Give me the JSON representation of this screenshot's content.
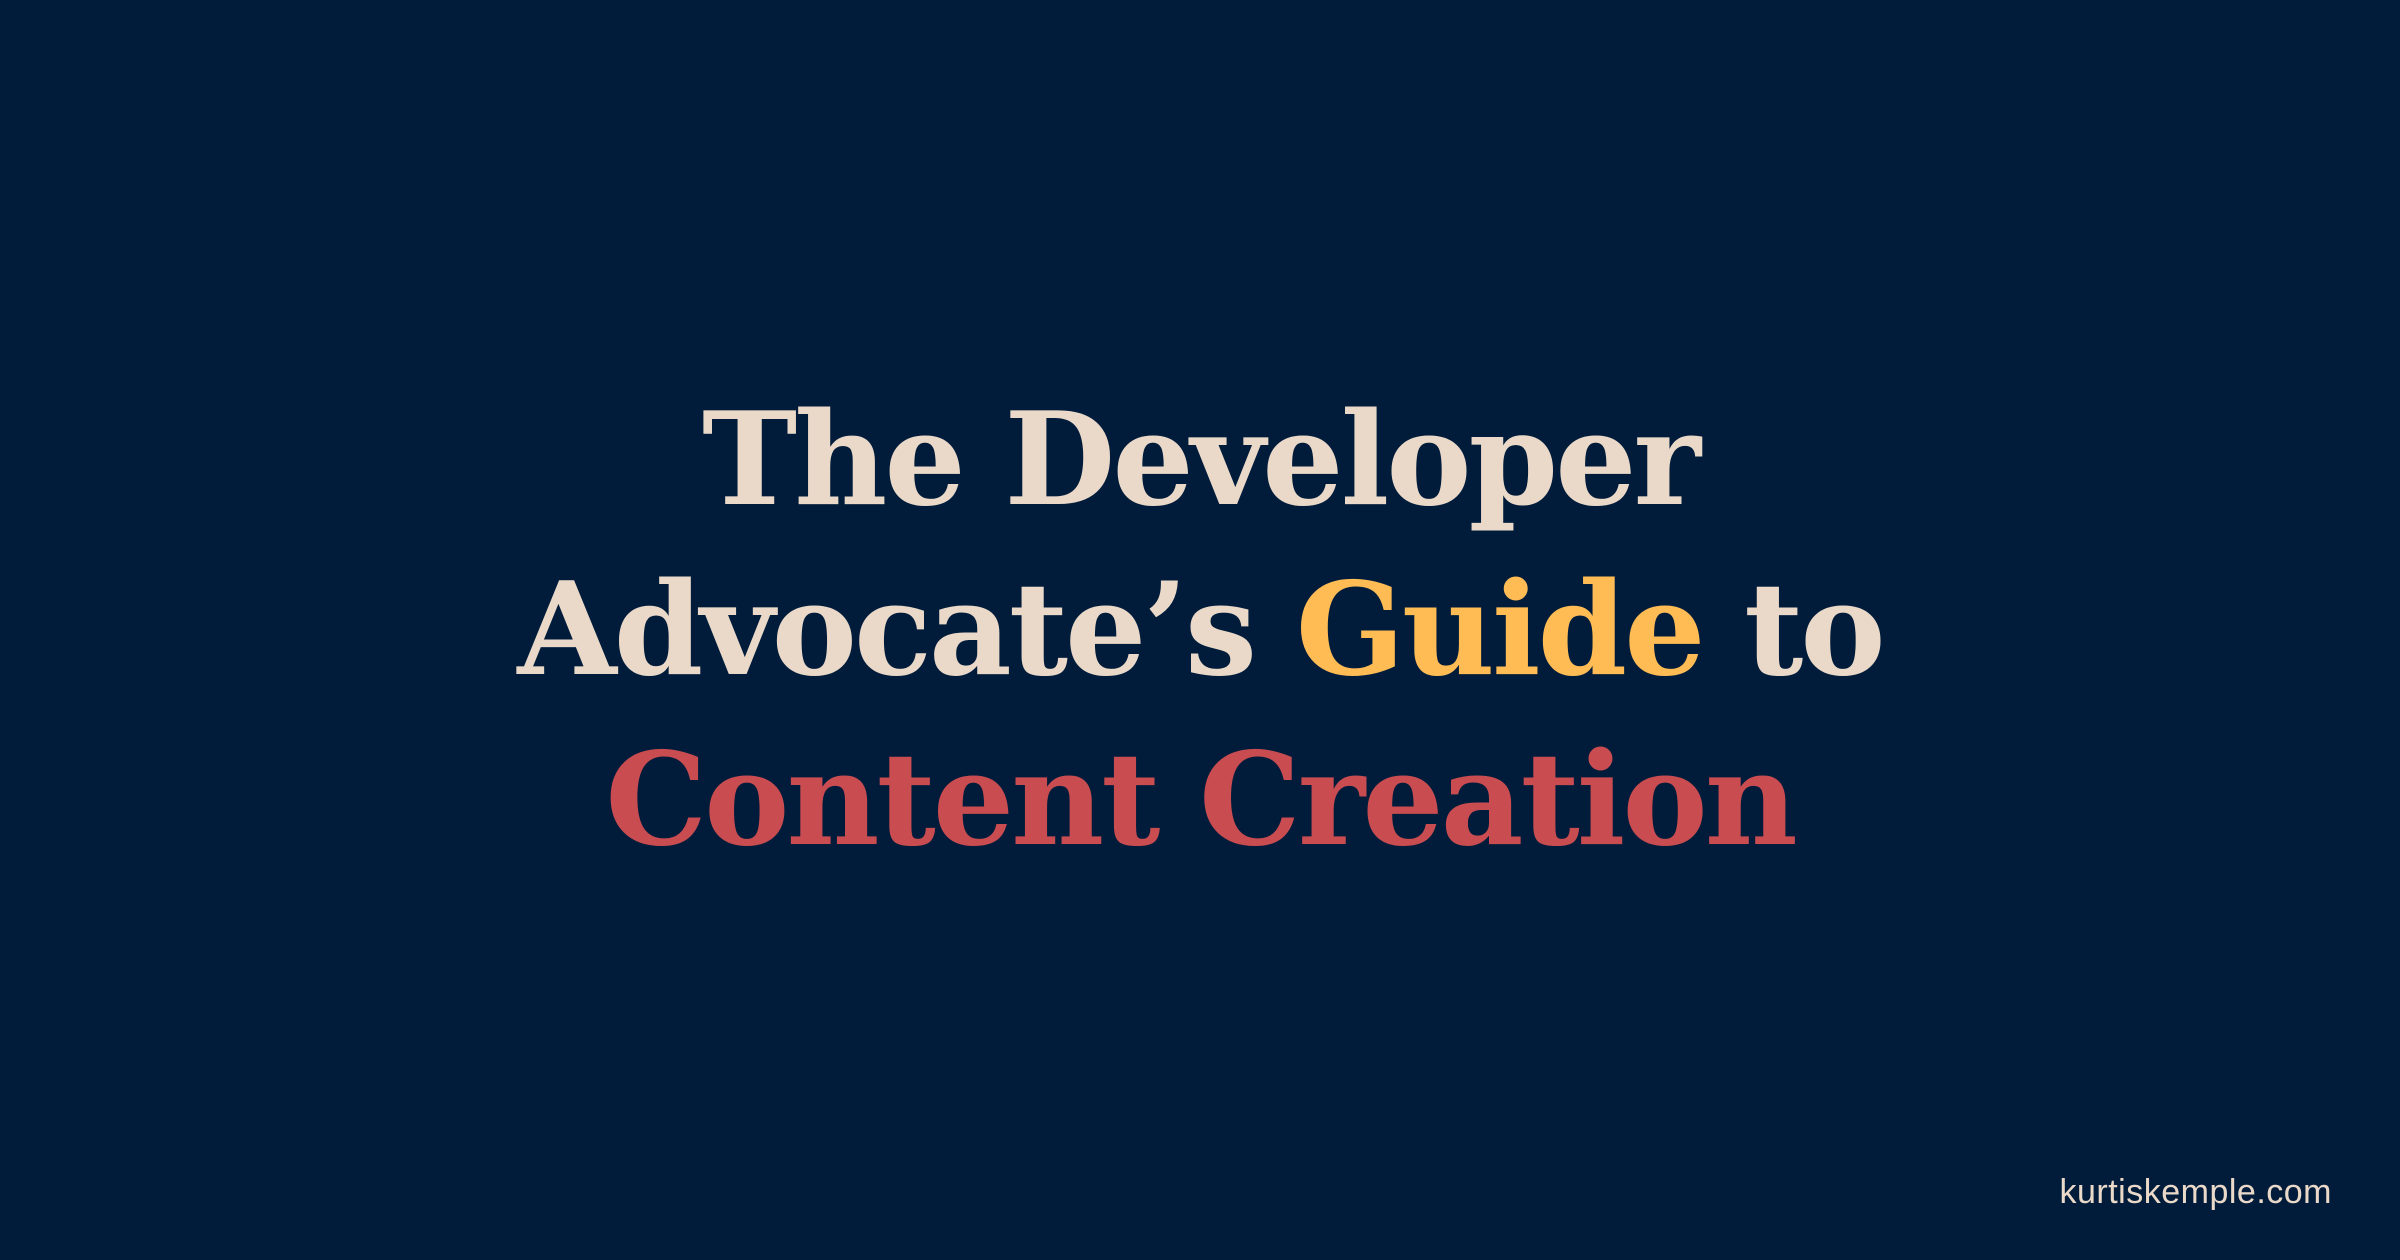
{
  "title": {
    "line1": "The Developer",
    "line2_part1": "Advocate’s ",
    "line2_highlight": "Guide",
    "line2_part2": " to",
    "line3": "Content Creation"
  },
  "footer": {
    "site": "kurtiskemple.com"
  },
  "colors": {
    "background": "#011c3b",
    "primary_text": "#ead9c9",
    "highlight_gold": "#ffbc55",
    "highlight_red": "#c84c50"
  }
}
